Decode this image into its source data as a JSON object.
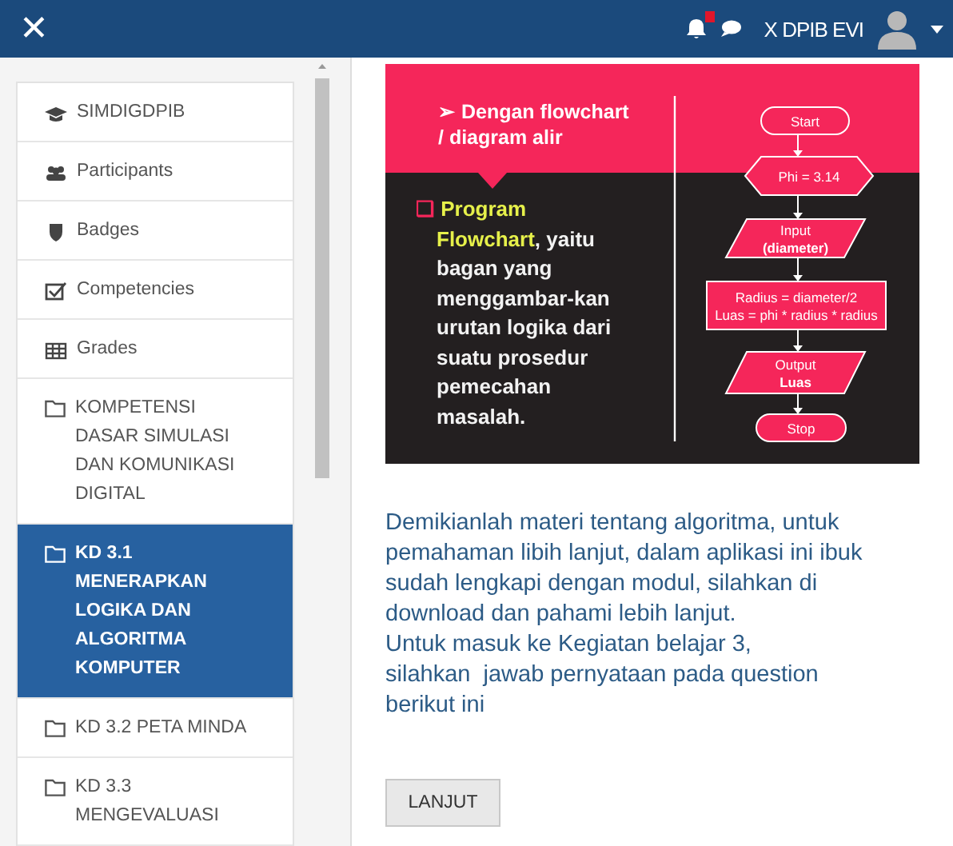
{
  "navbar": {
    "close": "✕",
    "notifications": {
      "has_new": true
    },
    "user_name": "X DPIB EVI"
  },
  "sidebar": {
    "items": [
      {
        "kind": "course",
        "label": "SIMDIGDPIB",
        "selected": false
      },
      {
        "kind": "users",
        "label": "Participants",
        "selected": false
      },
      {
        "kind": "badge",
        "label": "Badges",
        "selected": false
      },
      {
        "kind": "competency",
        "label": "Competencies",
        "selected": false
      },
      {
        "kind": "grades",
        "label": "Grades",
        "selected": false
      },
      {
        "kind": "folder",
        "label": "KOMPETENSI DASAR SIMULASI DAN KOMUNIKASI DIGITAL",
        "selected": false
      },
      {
        "kind": "folder",
        "label": "KD 3.1 MENERAPKAN LOGIKA DAN ALGORITMA KOMPUTER",
        "selected": true
      },
      {
        "kind": "folder",
        "label": "KD 3.2 PETA MINDA",
        "selected": false
      },
      {
        "kind": "folder",
        "label": "KD 3.3 MENGEVALUASI",
        "selected": false
      }
    ]
  },
  "slide": {
    "heading": [
      "➢ Dengan flowchart",
      "/ diagram alir"
    ],
    "bullet": "❑",
    "term": "Program Flowchart",
    "definition": ", yaitu bagan yang menggambar-kan urutan logika dari suatu prosedur pemecahan masalah.",
    "flowchart": [
      {
        "kind": "terminal",
        "lines": [
          "Start"
        ]
      },
      {
        "kind": "preparation",
        "lines": [
          "Phi = 3.14"
        ]
      },
      {
        "kind": "io",
        "lines": [
          "Input",
          "(diameter)"
        ]
      },
      {
        "kind": "process",
        "lines": [
          "Radius = diameter/2",
          "Luas = phi * radius * radius"
        ]
      },
      {
        "kind": "io",
        "lines": [
          "Output",
          "Luas"
        ]
      },
      {
        "kind": "terminal",
        "lines": [
          "Stop"
        ]
      }
    ]
  },
  "content": {
    "paragraphs": [
      "Demikianlah materi tentang algoritma, untuk pemahaman libih lanjut, dalam aplikasi ini ibuk sudah lengkapi dengan modul, silahkan di download dan pahami lebih lanjut.",
      "Untuk masuk ke Kegiatan belajar 3,",
      "silahkan  jawab pernyataan pada question berikut ini"
    ],
    "button": "LANJUT"
  }
}
